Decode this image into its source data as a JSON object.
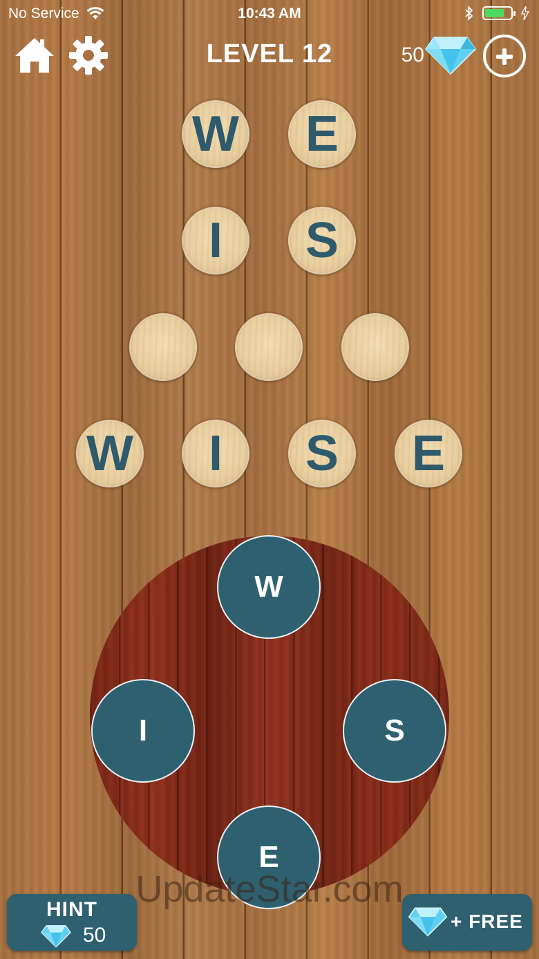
{
  "status_bar": {
    "carrier": "No Service",
    "time": "10:43 AM",
    "battery_fraction": 0.75
  },
  "header": {
    "level_title": "LEVEL 12",
    "gems": "50"
  },
  "board": {
    "tiles": [
      {
        "letter": "W"
      },
      {
        "letter": "E"
      },
      {
        "letter": "I"
      },
      {
        "letter": "S"
      },
      {
        "letter": ""
      },
      {
        "letter": ""
      },
      {
        "letter": ""
      },
      {
        "letter": "W"
      },
      {
        "letter": "I"
      },
      {
        "letter": "S"
      },
      {
        "letter": "E"
      }
    ]
  },
  "wheel": {
    "letters": [
      "W",
      "I",
      "S",
      "E"
    ]
  },
  "watermark": "UpdateStar.com",
  "hint": {
    "label": "HINT",
    "cost": "50"
  },
  "free": {
    "label": "+ FREE"
  },
  "colors": {
    "accent": "#2f6070",
    "tile_letter": "#2e5a6b",
    "gem": "#5fd0f0",
    "battery": "#4cd964"
  },
  "icons": [
    "wifi-icon",
    "bluetooth-icon",
    "battery-icon",
    "home-icon",
    "gear-icon",
    "diamond-icon",
    "plus-icon"
  ]
}
